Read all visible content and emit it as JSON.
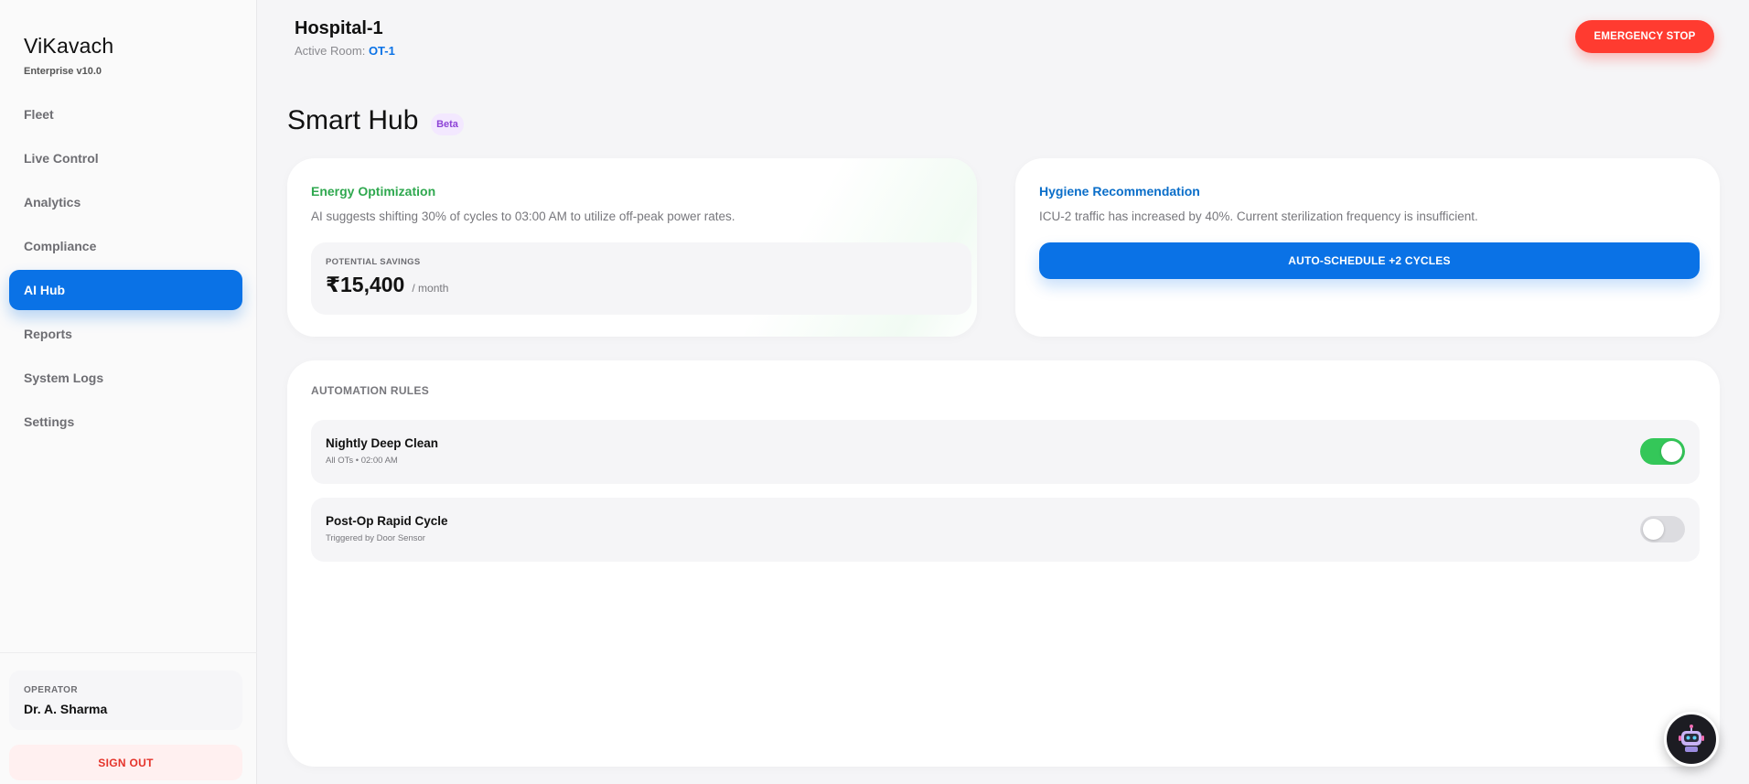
{
  "brand": {
    "name": "ViKavach",
    "version": "Enterprise v10.0"
  },
  "nav": {
    "items": [
      {
        "label": "Fleet"
      },
      {
        "label": "Live Control"
      },
      {
        "label": "Analytics"
      },
      {
        "label": "Compliance"
      },
      {
        "label": "AI Hub"
      },
      {
        "label": "Reports"
      },
      {
        "label": "System Logs"
      },
      {
        "label": "Settings"
      }
    ],
    "active_index": 4
  },
  "operator": {
    "label": "OPERATOR",
    "name": "Dr. A. Sharma"
  },
  "signout_label": "SIGN OUT",
  "topbar": {
    "hospital": "Hospital-1",
    "room_label": "Active Room:",
    "room_value": "OT-1",
    "emergency_label": "EMERGENCY STOP"
  },
  "page": {
    "title": "Smart Hub",
    "badge": "Beta"
  },
  "energy": {
    "title": "Energy Optimization",
    "description": "AI suggests shifting 30% of cycles to 03:00 AM to utilize off-peak power rates.",
    "savings_label": "POTENTIAL SAVINGS",
    "savings_value": "₹15,400",
    "savings_unit": "/ month"
  },
  "hygiene": {
    "title": "Hygiene Recommendation",
    "description": "ICU-2 traffic has increased by 40%. Current sterilization frequency is insufficient.",
    "button_label": "AUTO-SCHEDULE +2 CYCLES"
  },
  "rules": {
    "title": "AUTOMATION RULES",
    "items": [
      {
        "name": "Nightly Deep Clean",
        "meta": "All OTs • 02:00 AM",
        "enabled": true
      },
      {
        "name": "Post-Op Rapid Cycle",
        "meta": "Triggered by Door Sensor",
        "enabled": false
      }
    ]
  },
  "colors": {
    "accent": "#0a72e6",
    "danger": "#ff3b30",
    "success": "#34c759",
    "energy_title": "#2fa84f",
    "hygiene_title": "#0a6ec9",
    "beta": "#8e44d6"
  },
  "icons": {
    "assistant": "robot-icon"
  }
}
